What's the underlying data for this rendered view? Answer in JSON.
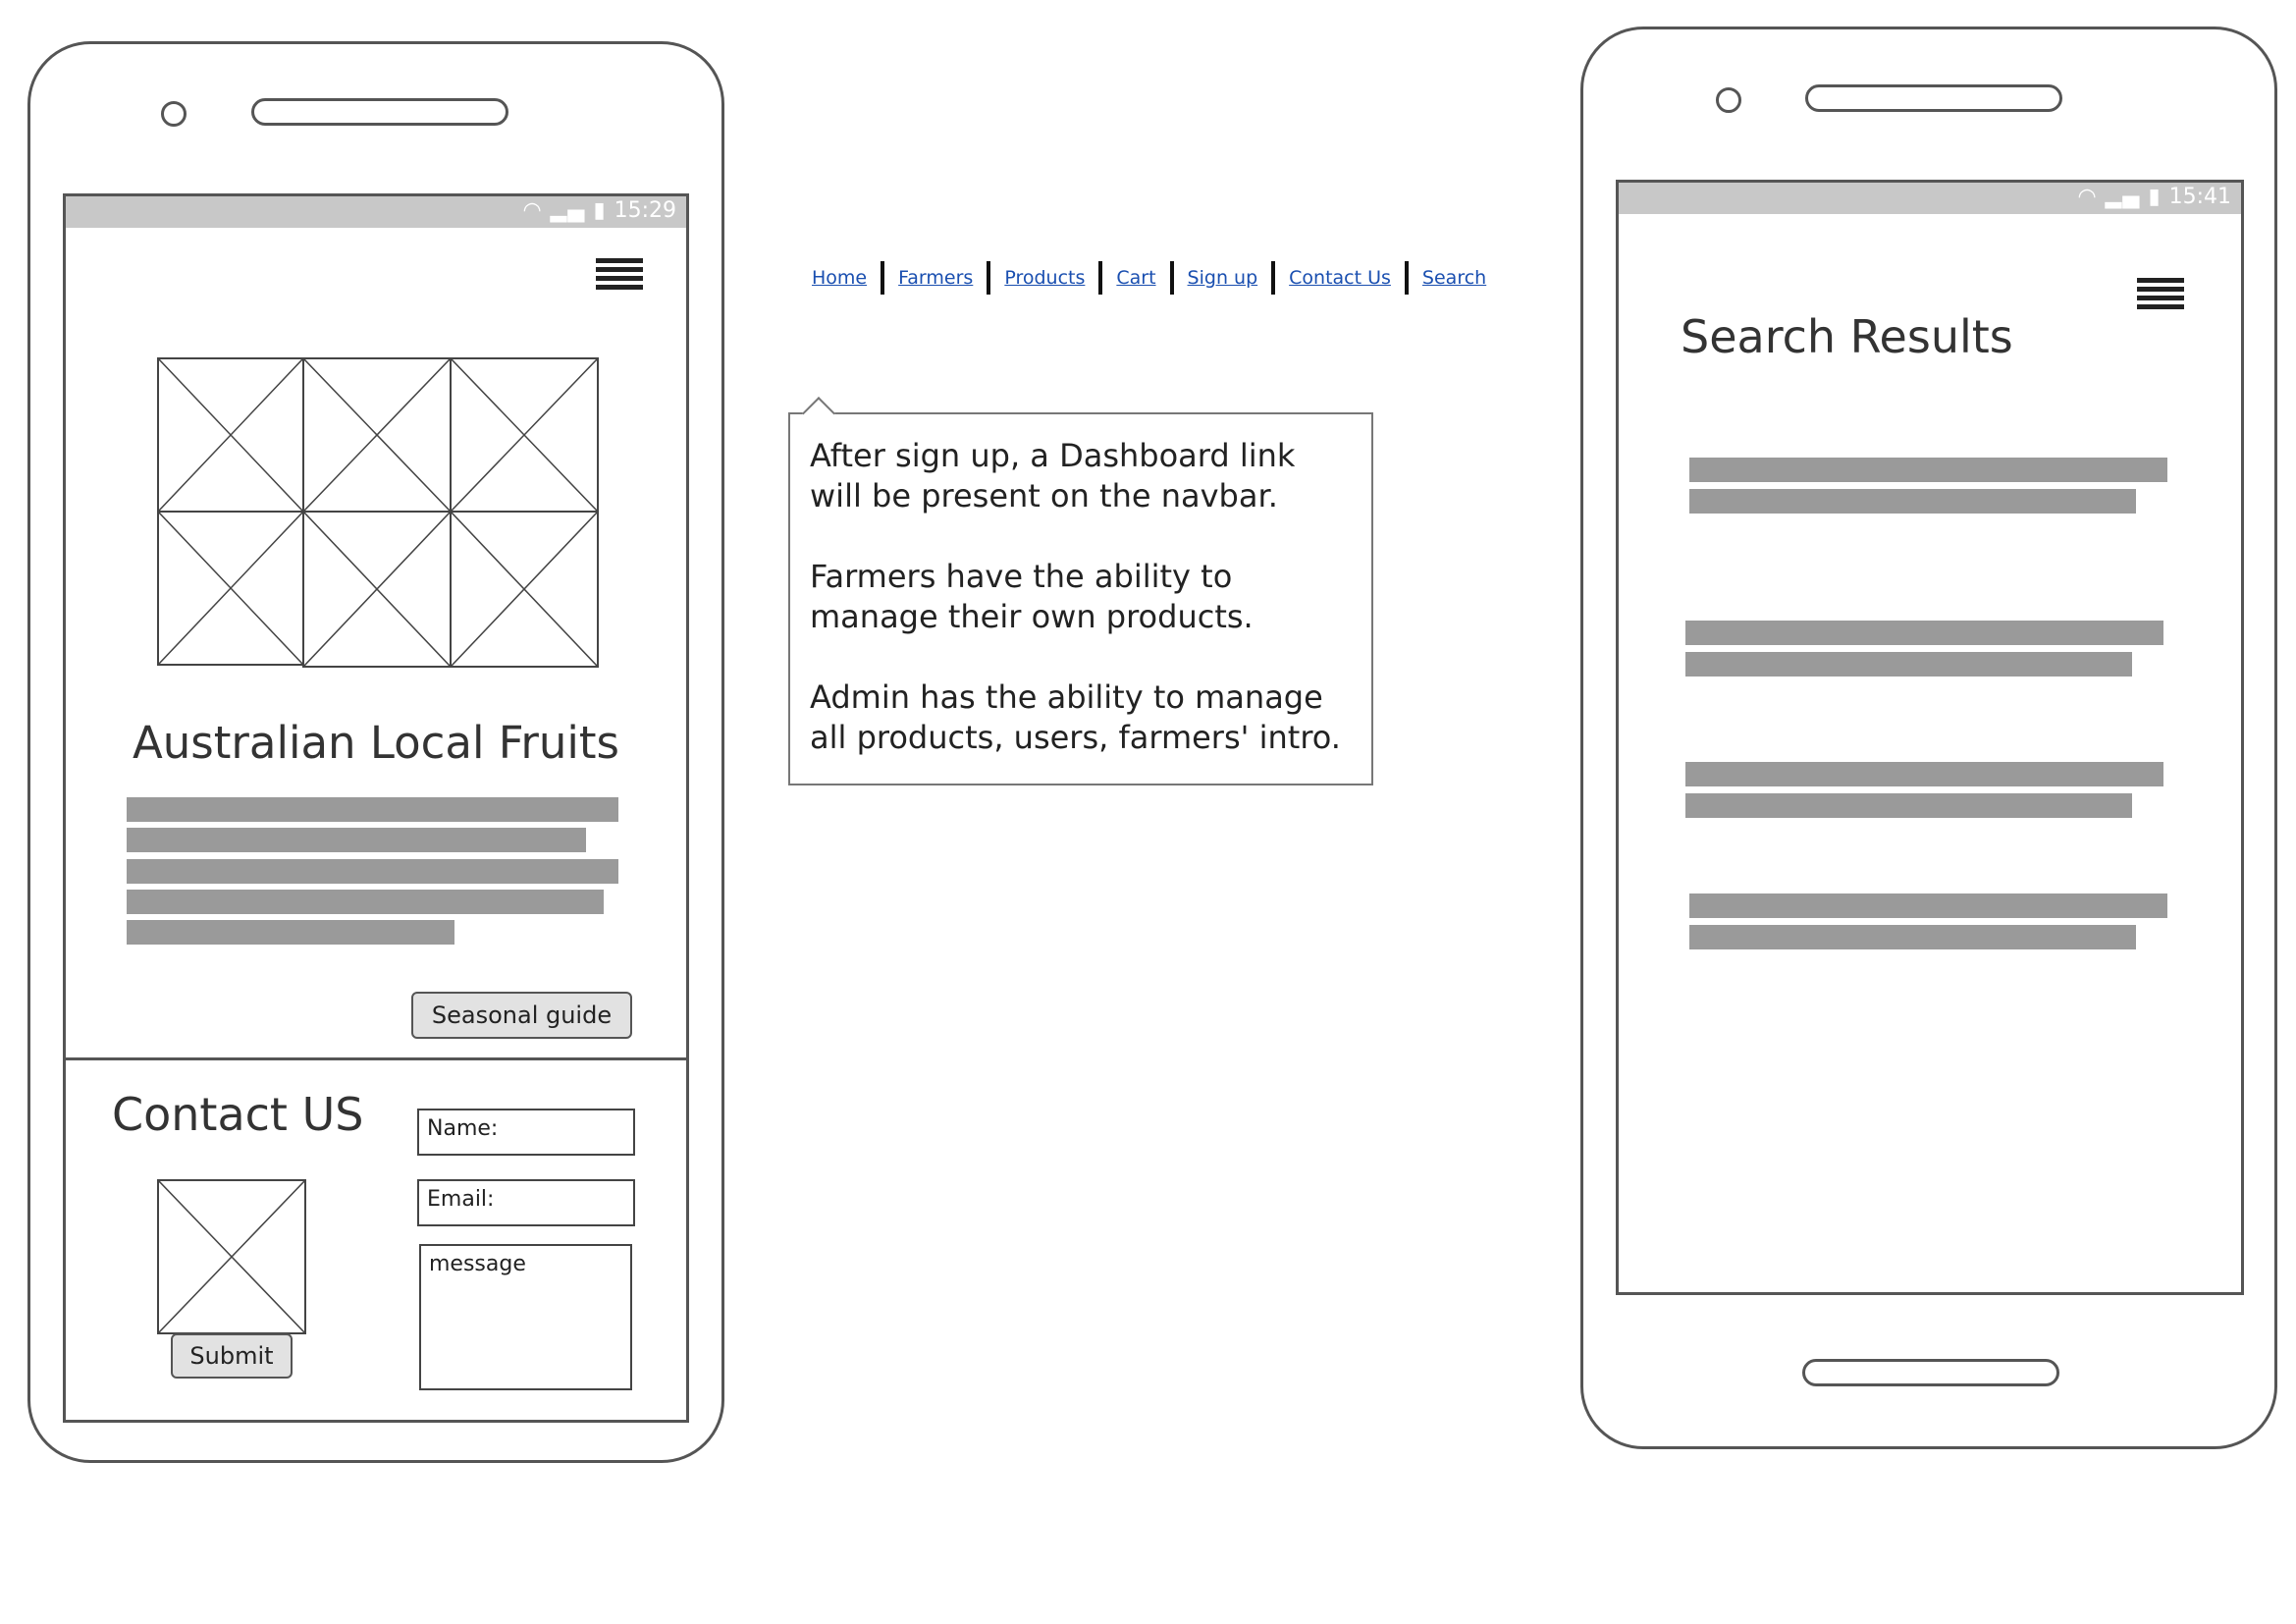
{
  "navbar": {
    "links": [
      "Home",
      "Farmers",
      "Products",
      "Cart",
      "Sign up",
      "Contact Us",
      "Search"
    ]
  },
  "callout": {
    "paragraphs": [
      "After sign up, a Dashboard link will be present on the navbar.",
      "Farmers have the ability to manage their own products.",
      "Admin has the ability to manage all products, users, farmers' intro."
    ]
  },
  "phone_home": {
    "status_time": "15:29",
    "heading": "Australian Local Fruits",
    "seasonal_button": "Seasonal guide",
    "contact": {
      "heading": "Contact US",
      "name_placeholder": "Name:",
      "email_placeholder": "Email:",
      "message_placeholder": "message",
      "submit_label": "Submit"
    }
  },
  "phone_search": {
    "status_time": "15:41",
    "heading": "Search Results"
  },
  "icons": {
    "menu": "hamburger-menu-icon",
    "image_placeholder": "image-placeholder-icon",
    "status": [
      "wifi-icon",
      "signal-icon",
      "battery-icon"
    ]
  },
  "colors": {
    "frame": "#555555",
    "status_bar": "#c8c8c8",
    "text_placeholder": "#9a9a9a",
    "link": "#1a4fb0",
    "button_bg": "#e2e2e2"
  }
}
